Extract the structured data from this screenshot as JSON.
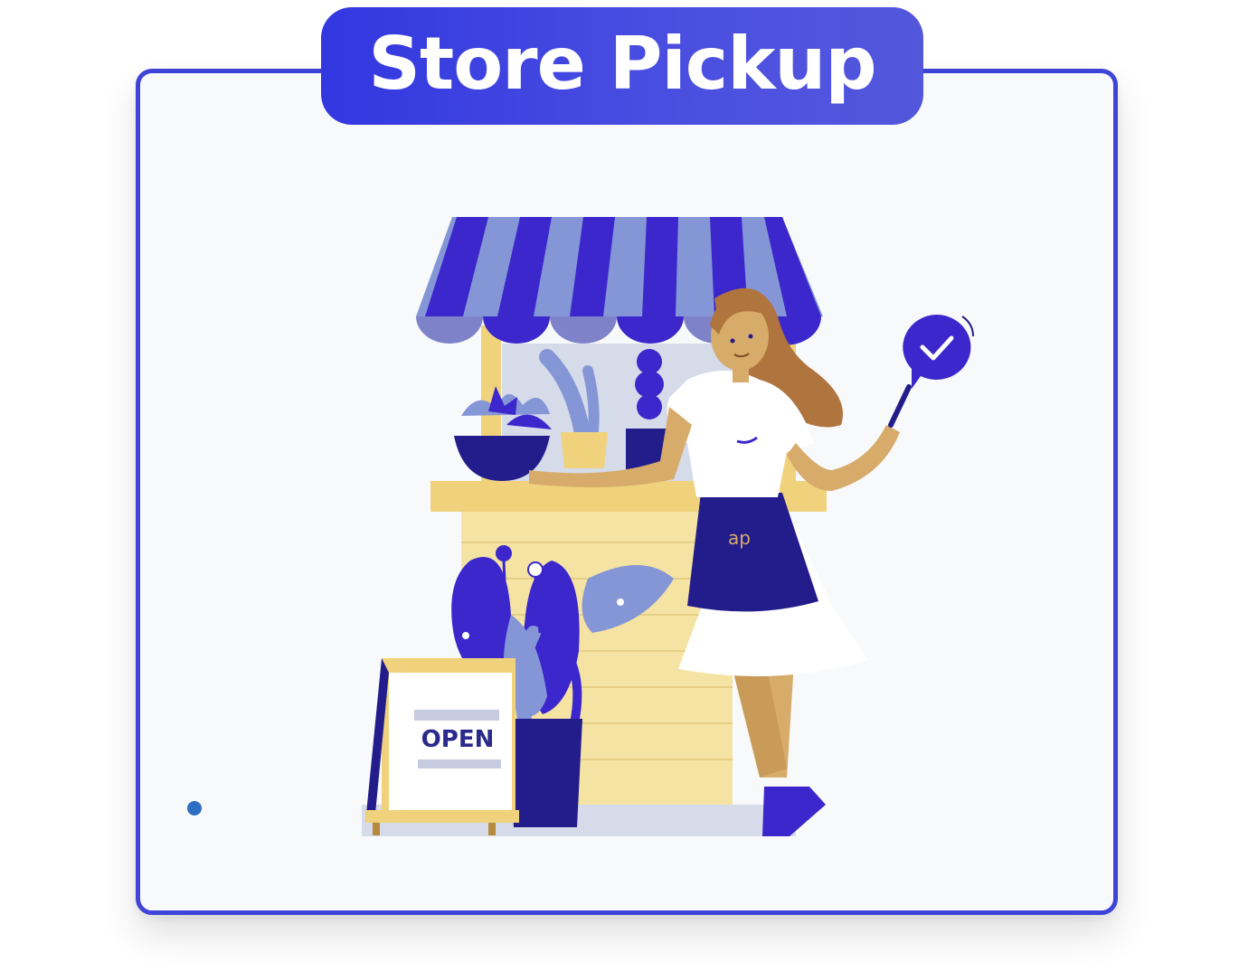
{
  "title": "Store Pickup",
  "illustration": {
    "sign_text": "OPEN",
    "icons": [
      "awning-icon",
      "check-badge-icon",
      "plant-icon",
      "sign-board-icon"
    ]
  },
  "colors": {
    "accent": "#3f44d8",
    "navy": "#262191",
    "periwinkle": "#8596d6",
    "cream": "#f5e3a4",
    "mustard": "#f0d27c",
    "skin": "#d7ab6a",
    "hair": "#b0743f"
  }
}
